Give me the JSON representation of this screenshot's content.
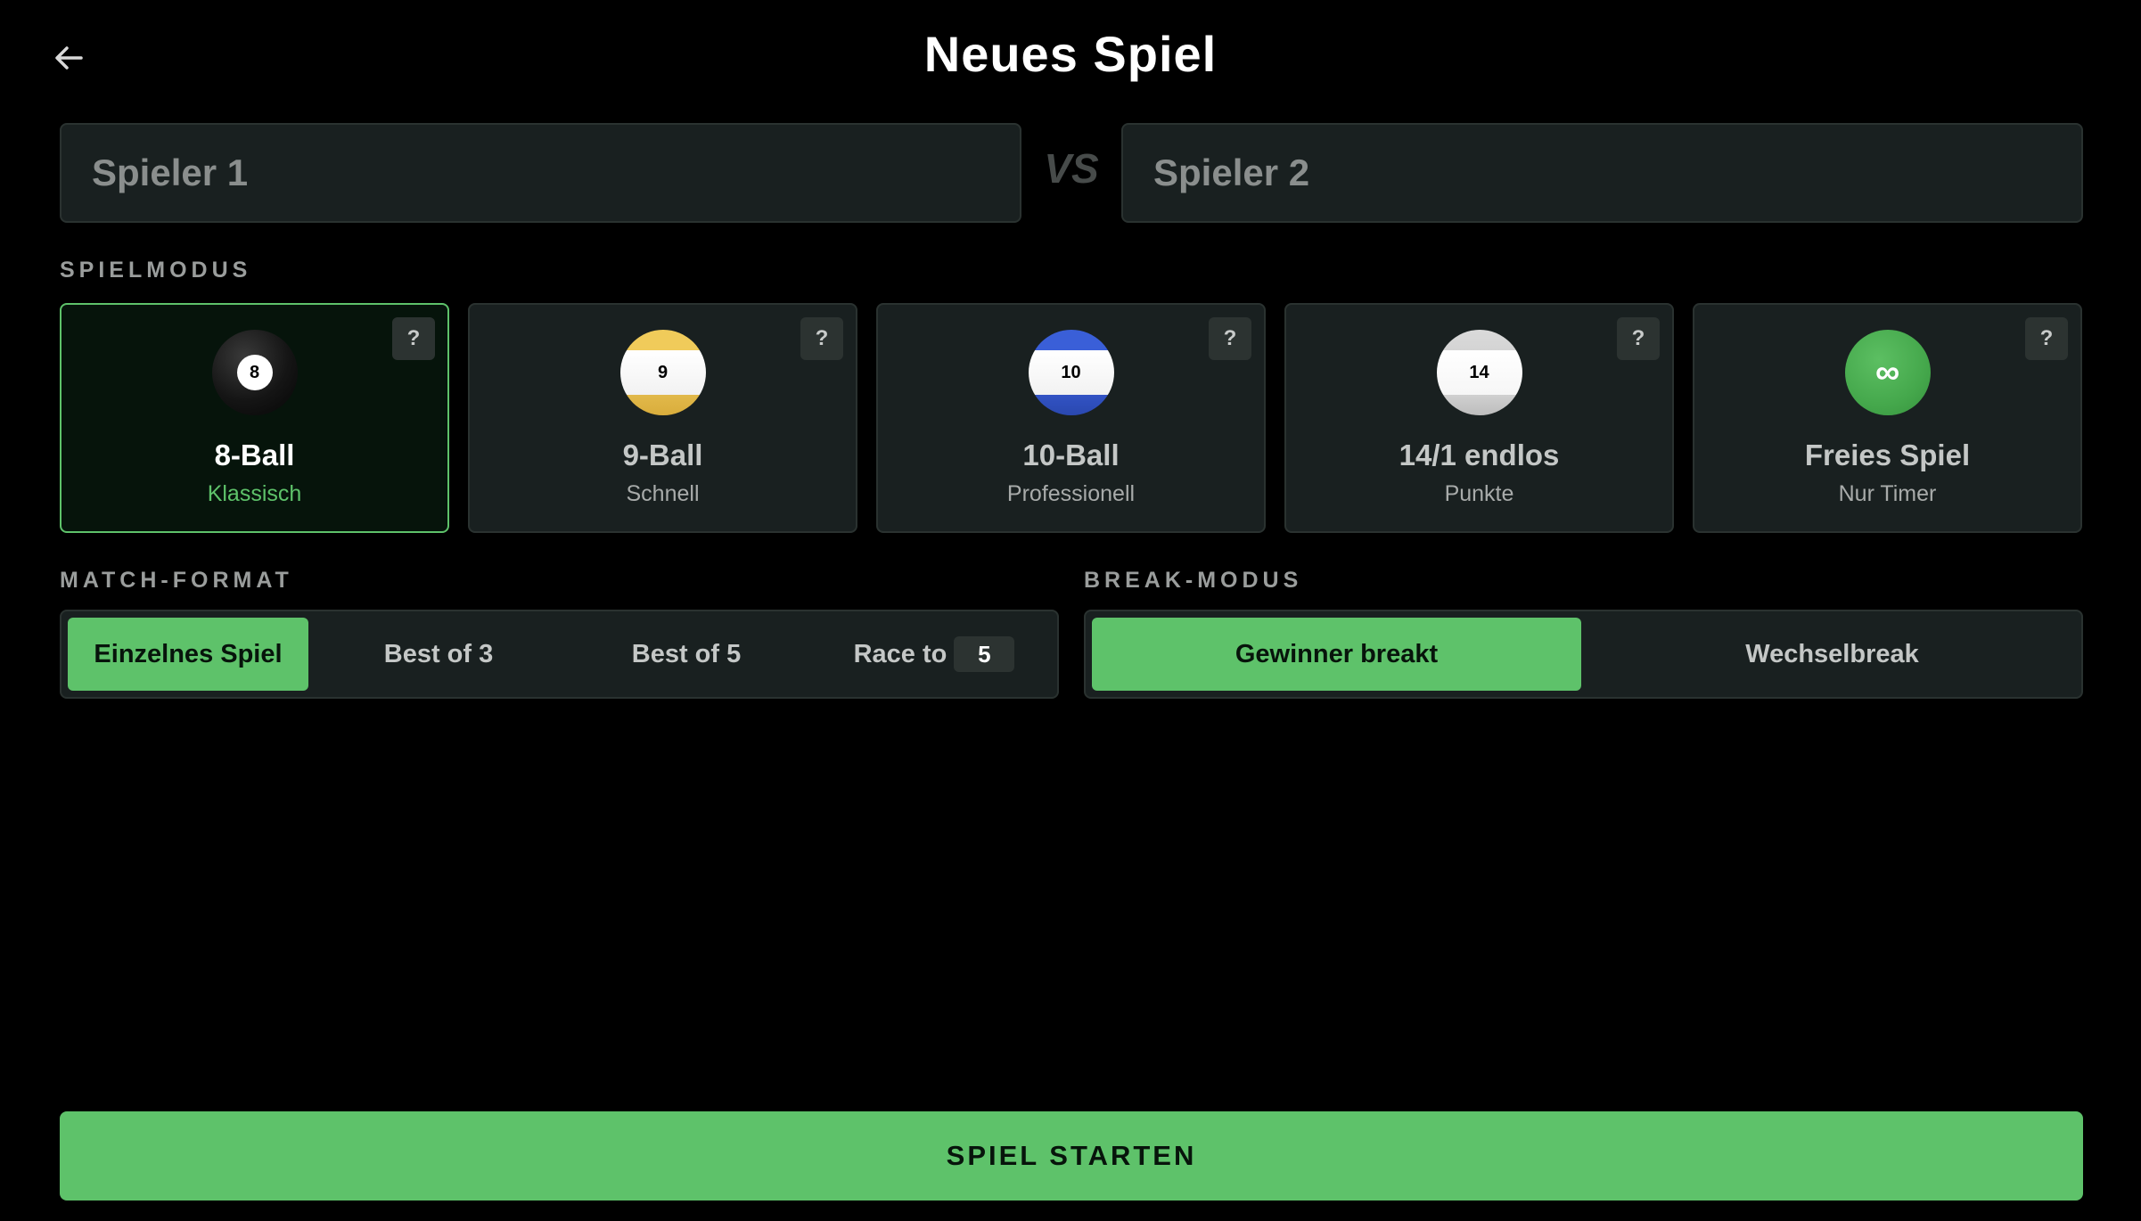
{
  "header": {
    "title": "Neues Spiel",
    "back_icon": "arrow-left-icon"
  },
  "players": {
    "player1_placeholder": "Spieler 1",
    "player1_value": "",
    "vs_label": "VS",
    "player2_placeholder": "Spieler 2",
    "player2_value": ""
  },
  "game_mode": {
    "label": "SPIELMODUS",
    "selected": "8-Ball",
    "modes": [
      {
        "name": "8-Ball",
        "subtitle": "Klassisch",
        "ball_number": "8",
        "ball_style": "solid",
        "ball_color": "#1a1a1a",
        "help": "?",
        "active": true
      },
      {
        "name": "9-Ball",
        "subtitle": "Schnell",
        "ball_number": "9",
        "ball_style": "stripe",
        "ball_color": "#f0cb5a",
        "help": "?",
        "active": false
      },
      {
        "name": "10-Ball",
        "subtitle": "Professionell",
        "ball_number": "10",
        "ball_style": "stripe",
        "ball_color": "#3a5fd8",
        "help": "?",
        "active": false
      },
      {
        "name": "14/1 endlos",
        "subtitle": "Punkte",
        "ball_number": "14",
        "ball_style": "stripe",
        "ball_color": "#d9d9d9",
        "help": "?",
        "active": false
      },
      {
        "name": "Freies Spiel",
        "subtitle": "Nur Timer",
        "ball_number": "∞",
        "ball_style": "infinity",
        "ball_color": "#4caf50",
        "help": "?",
        "active": false
      }
    ]
  },
  "match_format": {
    "label": "MATCH-FORMAT",
    "options": [
      {
        "label": "Einzelnes Spiel",
        "active": true
      },
      {
        "label": "Best of 3",
        "active": false
      },
      {
        "label": "Best of 5",
        "active": false
      },
      {
        "label": "Race to",
        "active": false,
        "value": "5"
      }
    ]
  },
  "break_mode": {
    "label": "BREAK-MODUS",
    "options": [
      {
        "label": "Gewinner breakt",
        "active": true
      },
      {
        "label": "Wechselbreak",
        "active": false
      }
    ]
  },
  "start": {
    "label": "SPIEL STARTEN"
  },
  "colors": {
    "accent": "#5ec26a",
    "card_bg": "#192020",
    "border": "#2a3230",
    "background": "#000000"
  }
}
